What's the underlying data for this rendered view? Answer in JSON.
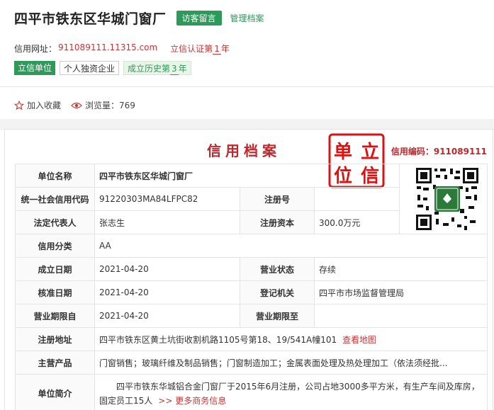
{
  "header": {
    "title": "四平市铁东区华城门窗厂",
    "tab_guestbook": "访客留言",
    "tab_archive": "管理档案",
    "url_label": "信用网址：",
    "url_value": "911089111.11315.com",
    "cert_prefix": "立信认证第",
    "cert_years": "1",
    "cert_suffix": "年",
    "tag_trusted": "立信单位",
    "tag_type": "个人独资企业",
    "history_prefix": "成立历史第",
    "history_years": "3",
    "history_suffix": "年",
    "favorite_label": "加入收藏",
    "views_label": "浏览量：",
    "views_value": "769"
  },
  "card": {
    "title": "信用档案",
    "credit_code_label": "信用编码：",
    "credit_code_value": "911089111",
    "stamp_text": [
      "单",
      "立",
      "位",
      "信"
    ],
    "rows": {
      "name_label": "单位名称",
      "name_value": "四平市铁东区华城门窗厂",
      "uscc_label": "统一社会信用代码",
      "uscc_value": "91220303MA84LFPC82",
      "regno_label": "注册号",
      "regno_value": "",
      "legal_label": "法定代表人",
      "legal_value": "张志生",
      "capital_label": "注册资本",
      "capital_value": "300.0万元",
      "class_label": "信用分类",
      "class_value": "AA",
      "founded_label": "成立日期",
      "founded_value": "2021-04-20",
      "status_label": "营业状态",
      "status_value": "存续",
      "approved_label": "核准日期",
      "approved_value": "2021-04-20",
      "authority_label": "登记机关",
      "authority_value": "四平市市场监督管理局",
      "term_from_label": "营业期限自",
      "term_from_value": "2021-04-20",
      "term_to_label": "营业期限至",
      "term_to_value": "",
      "address_label": "注册地址",
      "address_value": "四平市铁东区黄土坑街收割机路1105号第18、19/541A幢101",
      "map_link": "查看地图",
      "products_label": "主营产品",
      "products_value": "门窗销售；玻璃纤维及制品销售；门窗制造加工；金属表面处理及热处理加工（依法须经批...",
      "intro_label": "单位简介",
      "intro_value": "四平市铁东华城铝合金门窗厂于2015年6月注册，公司占地3000多平方米，有生产车间及库房，固定员工15人",
      "more_link": ">> 更多商务信息"
    }
  },
  "colors": {
    "accent_green": "#2c9a58",
    "accent_red": "#c0272d"
  }
}
